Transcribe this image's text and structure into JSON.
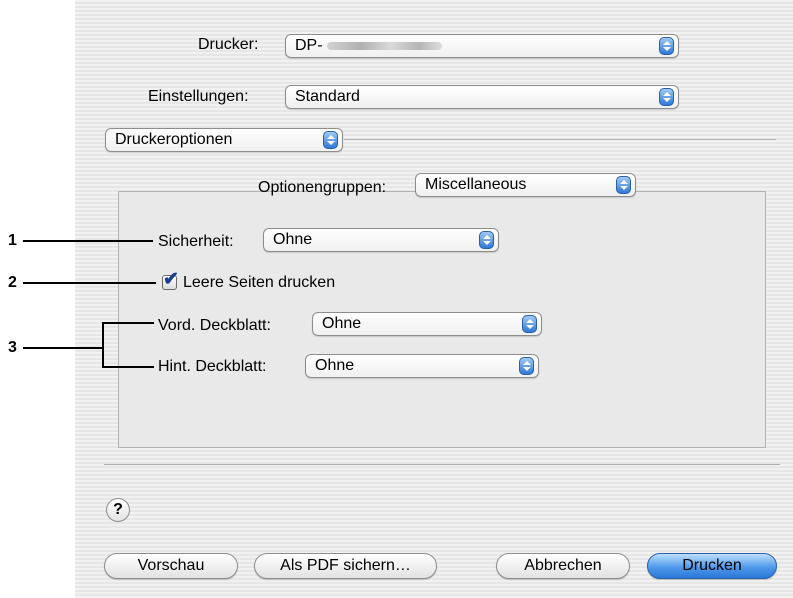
{
  "printer": {
    "label": "Drucker:",
    "value_prefix": "DP-"
  },
  "presets": {
    "label": "Einstellungen:",
    "value": "Standard"
  },
  "panel_menu": {
    "value": "Druckeroptionen"
  },
  "option_groups": {
    "label": "Optionengruppen:",
    "value": "Miscellaneous"
  },
  "security": {
    "label": "Sicherheit:",
    "value": "Ohne"
  },
  "blank_pages": {
    "label": "Leere Seiten drucken",
    "checked": true
  },
  "front_cover": {
    "label": "Vord. Deckblatt:",
    "value": "Ohne"
  },
  "back_cover": {
    "label": "Hint. Deckblatt:",
    "value": "Ohne"
  },
  "help": {
    "symbol": "?"
  },
  "buttons": {
    "preview": "Vorschau",
    "save_pdf": "Als PDF sichern…",
    "cancel": "Abbrechen",
    "print": "Drucken"
  },
  "callouts": [
    "1",
    "2",
    "3"
  ],
  "colors": {
    "accent": "#2f77d6",
    "dialog_bg": "#ececec"
  }
}
